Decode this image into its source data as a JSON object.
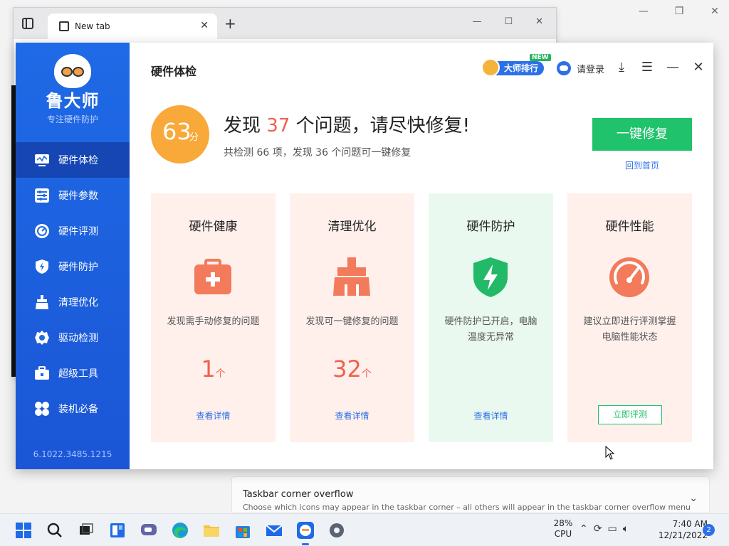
{
  "browser": {
    "tab_title": "New tab",
    "tab_close": "✕",
    "new_tab": "+",
    "min": "—",
    "max": "☐",
    "close": "✕"
  },
  "bg_settings": {
    "min": "—",
    "max": "❐",
    "close": "✕",
    "panel_title": "Taskbar corner overflow",
    "panel_desc": "Choose which icons may appear in the taskbar corner – all others will appear in the taskbar corner overflow menu"
  },
  "sidebar": {
    "brand": "鲁大师",
    "slogan": "专注硬件防护",
    "items": [
      {
        "label": "硬件体检",
        "icon": "monitor-icon"
      },
      {
        "label": "硬件参数",
        "icon": "sliders-icon"
      },
      {
        "label": "硬件评测",
        "icon": "gauge-icon"
      },
      {
        "label": "硬件防护",
        "icon": "shield-icon"
      },
      {
        "label": "清理优化",
        "icon": "broom-icon"
      },
      {
        "label": "驱动检测",
        "icon": "gear-icon"
      },
      {
        "label": "超级工具",
        "icon": "toolbox-icon"
      },
      {
        "label": "装机必备",
        "icon": "clover-icon"
      }
    ],
    "version": "6.1022.3485.1215"
  },
  "header": {
    "title": "硬件体检",
    "rank_label": "大师排行",
    "new_badge": "NEW",
    "login": "请登录"
  },
  "summary": {
    "score": "63",
    "score_unit": "分",
    "headline_pre": "发现 ",
    "headline_count": "37",
    "headline_post": " 个问题，请尽快修复!",
    "subline": "共检测 66 项，发现 36 个问题可一键修复",
    "fix_button": "一键修复",
    "home_link": "回到首页"
  },
  "cards": [
    {
      "title": "硬件健康",
      "desc": "发现需手动修复的问题",
      "count": "1",
      "unit": "个",
      "link": "查看详情",
      "bg": "#fff0ec",
      "icon": "medkit-icon"
    },
    {
      "title": "清理优化",
      "desc": "发现可一键修复的问题",
      "count": "32",
      "unit": "个",
      "link": "查看详情",
      "bg": "#fff0ec",
      "icon": "broom-icon"
    },
    {
      "title": "硬件防护",
      "desc": "硬件防护已开启，电脑温度无异常",
      "link": "查看详情",
      "bg": "#eaf9ef",
      "icon": "shield-bolt-icon"
    },
    {
      "title": "硬件性能",
      "desc": "建议立即进行评测掌握电脑性能状态",
      "button": "立即评测",
      "bg": "#fff0ec",
      "icon": "speedometer-icon"
    }
  ],
  "taskbar": {
    "cpu_value": "28%",
    "cpu_label": "CPU",
    "time": "7:40 AM",
    "date": "12/21/2022",
    "notifications": "2"
  },
  "colors": {
    "sidebar": "#1f6ae6",
    "accent_red": "#f0614c",
    "accent_green": "#20c26b",
    "score_orange": "#f8a93a"
  }
}
